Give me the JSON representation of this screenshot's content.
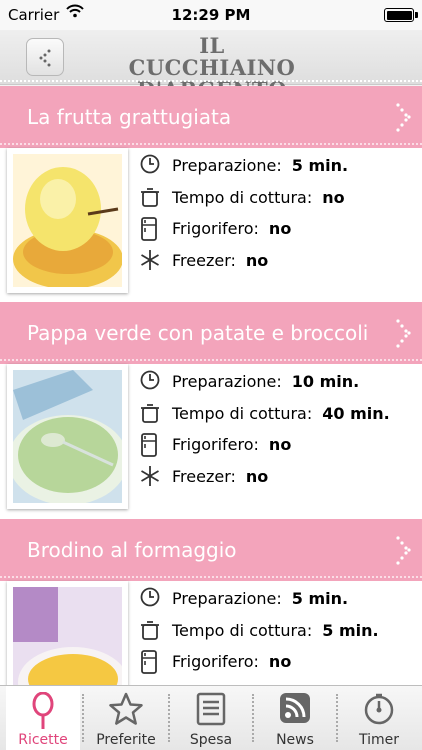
{
  "status": {
    "carrier": "Carrier",
    "time": "12:29 PM"
  },
  "header": {
    "logo_line1": "IL CUCCHIAINO",
    "logo_line2": "D'ARGENTO"
  },
  "labels": {
    "prep": "Preparazione:",
    "cook": "Tempo di cottura:",
    "fridge": "Frigorifero:",
    "freezer": "Freezer:"
  },
  "recipes": [
    {
      "title": "La frutta grattugiata",
      "prep": "5 min.",
      "cook": "no",
      "fridge": "no",
      "freezer": "no"
    },
    {
      "title": "Pappa verde con patate e broccoli",
      "prep": "10 min.",
      "cook": "40 min.",
      "fridge": "no",
      "freezer": "no"
    },
    {
      "title": "Brodino al formaggio",
      "prep": "5 min.",
      "cook": "5 min.",
      "fridge": "no"
    }
  ],
  "tabs": [
    {
      "label": "Ricette",
      "icon": "spoon-icon",
      "active": true
    },
    {
      "label": "Preferite",
      "icon": "star-icon"
    },
    {
      "label": "Spesa",
      "icon": "list-icon"
    },
    {
      "label": "News",
      "icon": "rss-icon"
    },
    {
      "label": "Timer",
      "icon": "timer-icon"
    }
  ],
  "colors": {
    "accent": "#f3a4bb",
    "active_tab": "#e0457b"
  }
}
